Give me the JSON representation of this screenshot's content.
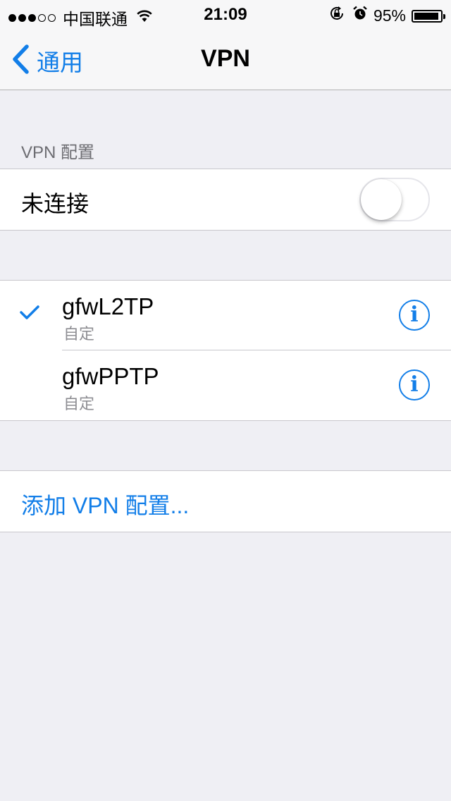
{
  "status_bar": {
    "signal_dots_filled": 3,
    "signal_dots_total": 5,
    "carrier": "中国联通",
    "time": "21:09",
    "battery_percent_text": "95%",
    "battery_level": 0.95,
    "icons": [
      "wifi-icon",
      "rotation-lock-icon",
      "alarm-icon",
      "battery-icon"
    ]
  },
  "nav": {
    "back_label": "通用",
    "title": "VPN"
  },
  "vpn_config": {
    "header": "VPN 配置",
    "status_label": "未连接",
    "toggle_on": false
  },
  "vpn_list": [
    {
      "name": "gfwL2TP",
      "type": "自定",
      "selected": true
    },
    {
      "name": "gfwPPTP",
      "type": "自定",
      "selected": false
    }
  ],
  "add_label": "添加 VPN 配置...",
  "colors": {
    "accent": "#127ee8",
    "background": "#efeff4",
    "separator": "#c8c7cc",
    "secondary_text": "#8e8e93"
  }
}
